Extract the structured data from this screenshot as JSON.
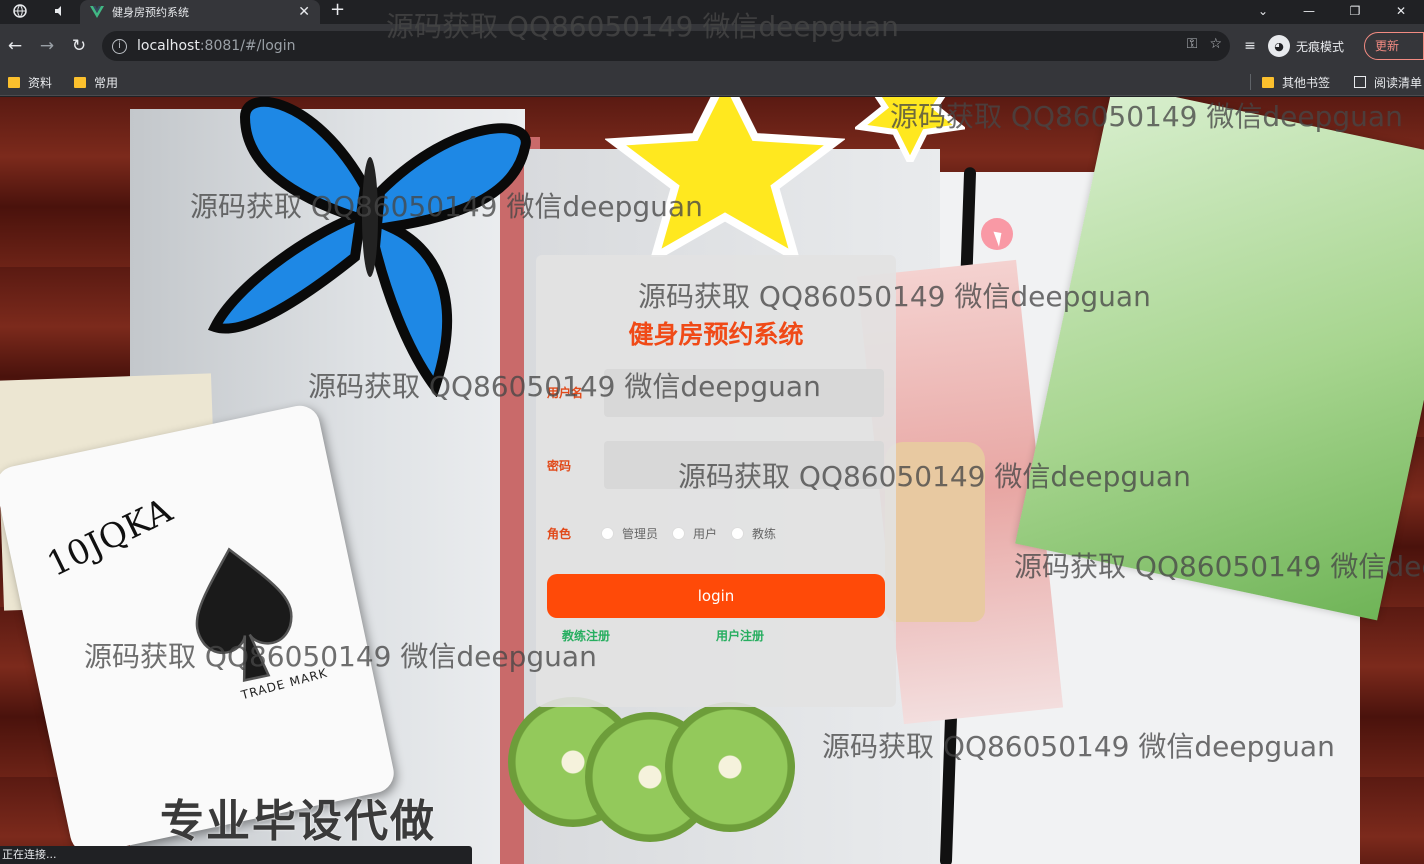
{
  "browser": {
    "tab_title": "健身房预约系统",
    "new_tab_symbol": "+",
    "url_host": "localhost",
    "url_rest": ":8081/#/login",
    "profile_label": "无痕模式",
    "update_label": "更新",
    "bookmarks": [
      "资料",
      "常用"
    ],
    "bookmarks_right": [
      "其他书签",
      "阅读清单"
    ],
    "status_text": "正在连接..."
  },
  "login": {
    "title": "健身房预约系统",
    "username_label": "用户名",
    "password_label": "密码",
    "role_label": "角色",
    "roles": [
      "管理员",
      "用户",
      "教练"
    ],
    "login_button": "login",
    "register_coach": "教练注册",
    "register_user": "用户注册"
  },
  "background": {
    "card_ranks": "10JQKA",
    "trade_mark": "TRADE  MARK",
    "promo_text": "专业毕设代做"
  },
  "watermark_text": "源码获取 QQ86050149 微信deepguan"
}
